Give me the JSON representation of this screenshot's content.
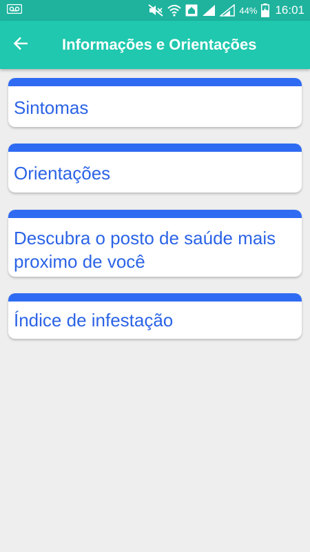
{
  "status_bar": {
    "battery_percent": "44%",
    "time": "16:01",
    "icons": [
      "voicemail-icon",
      "mute-icon",
      "wifi-icon",
      "home-icon",
      "signal-icon",
      "signal-icon",
      "battery-charging-icon"
    ]
  },
  "app_bar": {
    "title": "Informações e Orientações",
    "back_icon": "arrow-left-icon"
  },
  "menu": {
    "items": [
      {
        "label": "Sintomas"
      },
      {
        "label": "Orientações"
      },
      {
        "label": "Descubra o posto de saúde mais proximo de você"
      },
      {
        "label": "Índice de infestação"
      }
    ]
  },
  "colors": {
    "status_bar": "#1fb39e",
    "app_bar": "#1fc8ae",
    "card_accent": "#2f6bf2",
    "card_text": "#2b63e6",
    "background": "#eeeeee"
  }
}
